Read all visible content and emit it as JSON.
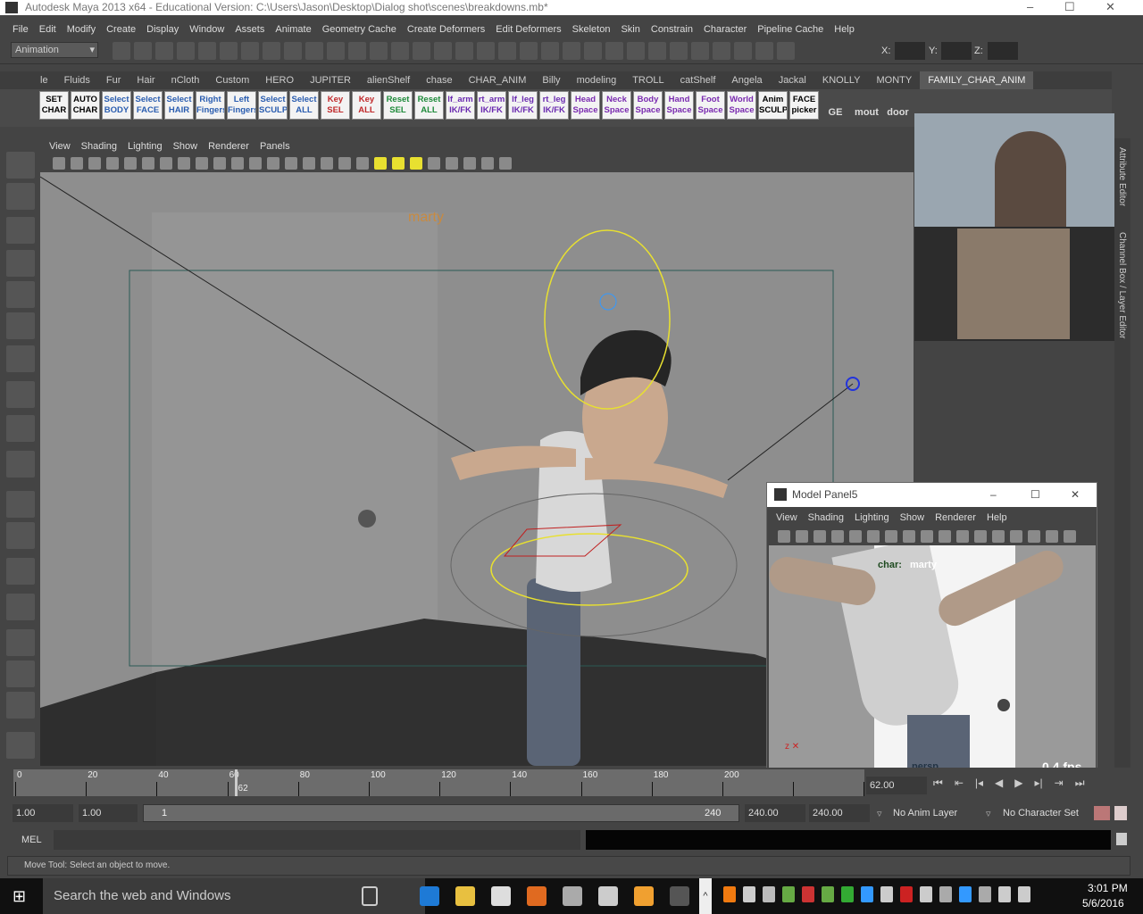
{
  "window": {
    "title": "Autodesk Maya 2013 x64 - Educational Version: C:\\Users\\Jason\\Desktop\\Dialog shot\\scenes\\breakdowns.mb*",
    "minimize": "–",
    "maximize": "☐",
    "close": "✕"
  },
  "menubar": [
    "File",
    "Edit",
    "Modify",
    "Create",
    "Display",
    "Window",
    "Assets",
    "Animate",
    "Geometry Cache",
    "Create Deformers",
    "Edit Deformers",
    "Skeleton",
    "Skin",
    "Constrain",
    "Character",
    "Pipeline Cache",
    "Help"
  ],
  "statusline": {
    "mode": "Animation",
    "x_label": "X:",
    "y_label": "Y:",
    "z_label": "Z:"
  },
  "shelf_tabs": [
    "le",
    "Fluids",
    "Fur",
    "Hair",
    "nCloth",
    "Custom",
    "HERO",
    "JUPITER",
    "alienShelf",
    "chase",
    "CHAR_ANIM",
    "Billy",
    "modeling",
    "TROLL",
    "catShelf",
    "Angela",
    "Jackal",
    "KNOLLY",
    "MONTY",
    "FAMILY_CHAR_ANIM"
  ],
  "shelf_active": "FAMILY_CHAR_ANIM",
  "shelf_buttons": [
    {
      "l1": "SET",
      "l2": "CHAR",
      "color": "#000000"
    },
    {
      "l1": "AUTO",
      "l2": "CHAR",
      "color": "#000000"
    },
    {
      "l1": "Select",
      "l2": "BODY",
      "color": "#2a5db0"
    },
    {
      "l1": "Select",
      "l2": "FACE",
      "color": "#2a5db0"
    },
    {
      "l1": "Select",
      "l2": "HAIR",
      "color": "#2a5db0"
    },
    {
      "l1": "Right",
      "l2": "Fingers",
      "color": "#2a5db0"
    },
    {
      "l1": "Left",
      "l2": "Fingers",
      "color": "#2a5db0"
    },
    {
      "l1": "Select",
      "l2": "SCULP",
      "color": "#2a5db0"
    },
    {
      "l1": "Select",
      "l2": "ALL",
      "color": "#2a5db0"
    },
    {
      "l1": "Key",
      "l2": "SEL",
      "color": "#c0282a"
    },
    {
      "l1": "Key",
      "l2": "ALL",
      "color": "#c0282a"
    },
    {
      "l1": "Reset",
      "l2": "SEL",
      "color": "#1e8a3a"
    },
    {
      "l1": "Reset",
      "l2": "ALL",
      "color": "#1e8a3a"
    },
    {
      "l1": "lf_arm",
      "l2": "IK/FK",
      "color": "#6a2ab0"
    },
    {
      "l1": "rt_arm",
      "l2": "IK/FK",
      "color": "#6a2ab0"
    },
    {
      "l1": "lf_leg",
      "l2": "IK/FK",
      "color": "#6a2ab0"
    },
    {
      "l1": "rt_leg",
      "l2": "IK/FK",
      "color": "#6a2ab0"
    },
    {
      "l1": "Head",
      "l2": "Space",
      "color": "#7a2ab0"
    },
    {
      "l1": "Neck",
      "l2": "Space",
      "color": "#7a2ab0"
    },
    {
      "l1": "Body",
      "l2": "Space",
      "color": "#7a2ab0"
    },
    {
      "l1": "Hand",
      "l2": "Space",
      "color": "#7a2ab0"
    },
    {
      "l1": "Foot",
      "l2": "Space",
      "color": "#7a2ab0"
    },
    {
      "l1": "World",
      "l2": "Space",
      "color": "#7a2ab0"
    },
    {
      "l1": "Anim",
      "l2": "SCULPT",
      "color": "#000000"
    },
    {
      "l1": "FACE",
      "l2": "picker",
      "color": "#000000"
    }
  ],
  "shelf_icons": [
    "GE",
    "mout",
    "door"
  ],
  "viewport": {
    "menu": [
      "View",
      "Shading",
      "Lighting",
      "Show",
      "Renderer",
      "Panels"
    ],
    "character_label": "marty"
  },
  "right_tabs": {
    "attribute_editor": "Attribute Editor",
    "channel_box": "Channel Box / Layer Editor"
  },
  "model_panel": {
    "title": "Model Panel5",
    "menu": [
      "View",
      "Shading",
      "Lighting",
      "Show",
      "Renderer",
      "Help"
    ],
    "hud_char_label": "char:",
    "hud_char_value": "marty",
    "camera": "persp",
    "fps": "0.4 fps"
  },
  "timeline": {
    "ticks": [
      0,
      20,
      40,
      60,
      80,
      100,
      120,
      140,
      160,
      180,
      200
    ],
    "current_frame": "62",
    "current_time": "62.00"
  },
  "range": {
    "start": "1.00",
    "anim_start": "1.00",
    "slider_start": "1",
    "slider_end": "240",
    "anim_end": "240.00",
    "end": "240.00",
    "anim_layer": "No Anim Layer",
    "character_set": "No Character Set"
  },
  "mel": {
    "label": "MEL"
  },
  "status": "Move Tool: Select an object to move.",
  "taskbar": {
    "search": "Search the web and Windows",
    "time": "3:01 PM",
    "date": "5/6/2016"
  },
  "colors": {
    "ui_bg": "#444444",
    "viewport_bg": "#8d8d8d",
    "accent_yellow": "#e8e030"
  }
}
